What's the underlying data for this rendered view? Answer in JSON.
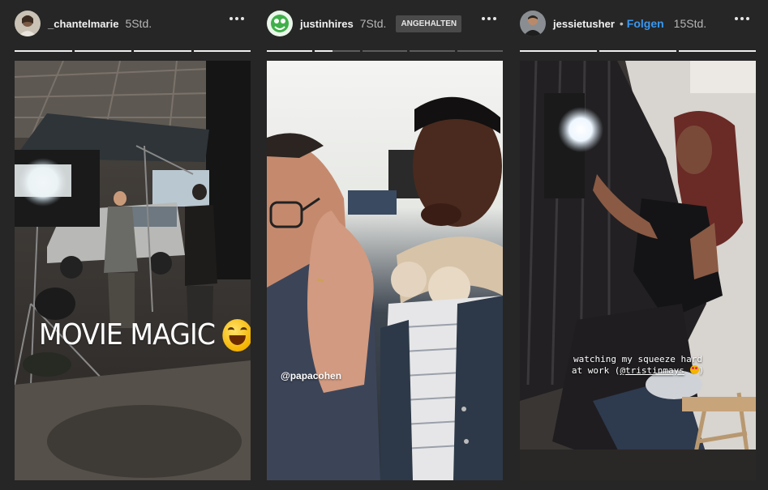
{
  "stories": [
    {
      "username": "_chantelmarie",
      "time": "5Std.",
      "segments": [
        1,
        1,
        1,
        1
      ],
      "caption": "MOVIE MAGIC",
      "caption_emoji": "face-with-tears-of-joy-emoji"
    },
    {
      "username": "justinhires",
      "time": "7Std.",
      "status_badge": "ANGEHALTEN",
      "segments": [
        1,
        0.4,
        0,
        0,
        0
      ],
      "mention": "@papacohen"
    },
    {
      "username": "jessietusher",
      "separator": "•",
      "follow_label": "Folgen",
      "time": "15Std.",
      "segments": [
        1,
        1,
        1
      ],
      "caption_line1": "watching my squeeze hard",
      "caption_line2_prefix": "at work (",
      "caption_line2_mention": "@tristinmays",
      "caption_line2_suffix": ")"
    }
  ],
  "icons": {
    "more": "more-options-icon",
    "avatar": "avatar"
  },
  "colors": {
    "background": "#262626",
    "follow": "#3897f0",
    "badge_bg": "#4a4a4a"
  }
}
